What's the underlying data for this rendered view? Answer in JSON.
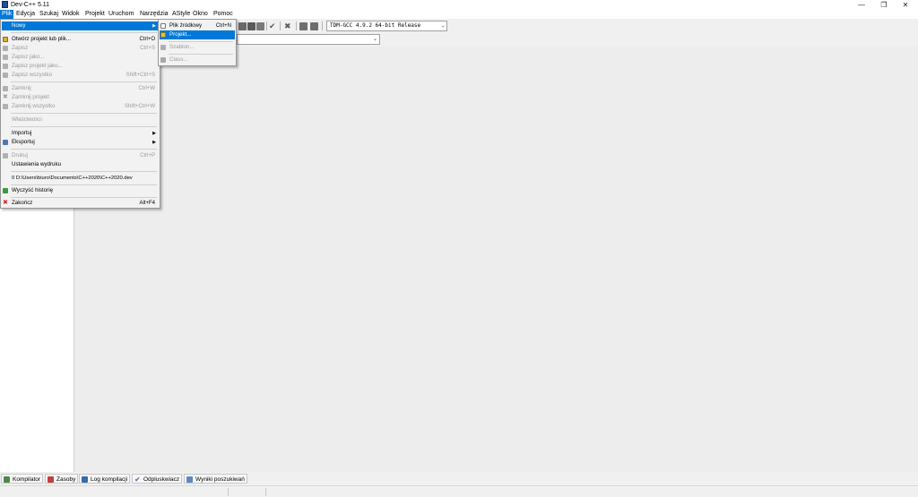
{
  "window": {
    "title": "Dev-C++ 5.11",
    "minimize": "—",
    "maximize": "❐",
    "close": "✕"
  },
  "menubar": [
    "Plik",
    "Edycja",
    "Szukaj",
    "Widok",
    "Projekt",
    "Uruchom",
    "Narzędzia",
    "AStyle",
    "Okno",
    "Pomoc"
  ],
  "toolbar": {
    "compiler_select": "TDM-GCC 4.9.2 64-bit Release",
    "second_select": ""
  },
  "file_menu": {
    "items": [
      {
        "label": "Nowy",
        "shortcut": "",
        "submenu": true
      },
      {
        "label": "Otwórz projekt lub plik...",
        "shortcut": "Ctrl+O"
      },
      {
        "label": "Zapisz",
        "shortcut": "Ctrl+S"
      },
      {
        "label": "Zapisz jako...",
        "shortcut": ""
      },
      {
        "label": "Zapisz projekt jako...",
        "shortcut": ""
      },
      {
        "label": "Zapisz wszystko",
        "shortcut": "Shift+Ctrl+S"
      },
      {
        "label": "Zamknij",
        "shortcut": "Ctrl+W"
      },
      {
        "label": "Zamknij projekt",
        "shortcut": ""
      },
      {
        "label": "Zamknij wszystko",
        "shortcut": "Shift+Ctrl+W"
      },
      {
        "label": "Właściwości",
        "shortcut": ""
      },
      {
        "label": "Importuj",
        "shortcut": "",
        "submenu": true
      },
      {
        "label": "Eksportuj",
        "shortcut": "",
        "submenu": true
      },
      {
        "label": "Drukuj",
        "shortcut": "Ctrl+P"
      },
      {
        "label": "Ustawienia wydruku",
        "shortcut": ""
      },
      {
        "label": "0 D:\\Users\\biuro\\Documents\\C++2020\\C++2020.dev",
        "shortcut": ""
      },
      {
        "label": "Wyczyść historię",
        "shortcut": ""
      },
      {
        "label": "Zakończ",
        "shortcut": "Alt+F4"
      }
    ]
  },
  "new_submenu": {
    "items": [
      {
        "label": "Plik źródłowy",
        "shortcut": "Ctrl+N"
      },
      {
        "label": "Projekt...",
        "shortcut": ""
      },
      {
        "label": "Szablon...",
        "shortcut": ""
      },
      {
        "label": "Class...",
        "shortcut": ""
      }
    ]
  },
  "bottom_tabs": [
    "Kompilator",
    "Zasoby",
    "Log kompilacji",
    "Odpluskwiacz",
    "Wyniki poszukiwań"
  ],
  "colors": {
    "highlight": "#0078d7",
    "disabled_text": "#9a9a9a"
  }
}
